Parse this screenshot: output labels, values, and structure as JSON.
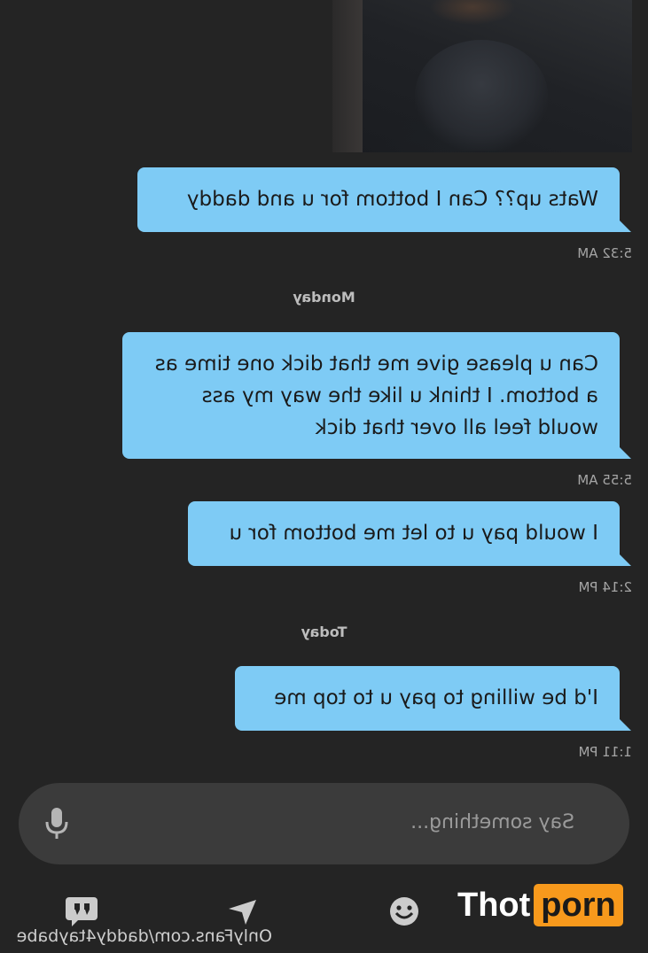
{
  "messages": [
    {
      "text": "Wats up??  Can I bottom for u and daddy",
      "time": "5:32 AM"
    },
    {
      "text": "Can u please give me that dick one time as a bottom. I think u like the way my ass would feel all over that dick",
      "time": "5:55 AM"
    },
    {
      "text": "I would pay u to let me bottom for u",
      "time": "2:14 PM"
    },
    {
      "text": "I'd be willing to pay u to top me",
      "time": "1:11 PM"
    }
  ],
  "day_separators": {
    "monday": "Monday",
    "today": "Today"
  },
  "composer": {
    "placeholder": "Say something..."
  },
  "icons": {
    "mic": "microphone-icon",
    "emoji": "emoji-icon",
    "send": "send-arrow-icon",
    "quote": "quote-bubble-icon"
  },
  "colors": {
    "bubble": "#7ecbf5",
    "background": "#242424",
    "input": "#3b3b3b",
    "logo_accent": "#f7991c"
  },
  "watermark": {
    "url": "OnlyFans.com/daddy4taybabe",
    "logo_part1": "Thot",
    "logo_part2": "porn"
  }
}
